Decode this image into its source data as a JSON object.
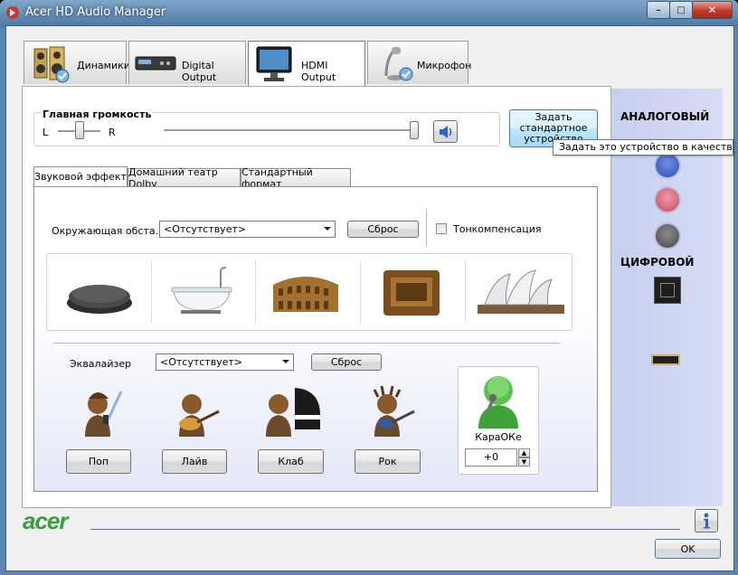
{
  "window": {
    "title": "Acer HD Audio Manager",
    "minimize": "–",
    "maximize": "□",
    "close": "✕"
  },
  "tabs": [
    {
      "label": "Динамики",
      "icon": "speakers-icon"
    },
    {
      "label": "Digital Output",
      "icon": "digital-output-icon"
    },
    {
      "label": "HDMI Output",
      "icon": "monitor-icon"
    },
    {
      "label": "Микрофон",
      "icon": "microphone-icon"
    }
  ],
  "volume": {
    "title": "Главная громкость",
    "left": "L",
    "right": "R",
    "balance_percent": 50,
    "level_percent": 100,
    "mute_icon": "speaker-icon"
  },
  "default_button": {
    "label": "Задать стандартное устройство",
    "tooltip": "Задать это устройство в качестве ста"
  },
  "subtabs": [
    "Звуковой эффект",
    "Домашний театр Dolby",
    "Стандартный формат"
  ],
  "environment": {
    "label": "Окружающая обста...",
    "value": "<Отсутствует>",
    "reset": "Сброс",
    "loudness": "Тонкомпенсация"
  },
  "environment_presets": [
    "stone-room-icon",
    "bathroom-icon",
    "colosseum-icon",
    "arena-icon",
    "opera-house-icon"
  ],
  "equalizer": {
    "label": "Эквалайзер",
    "value": "<Отсутствует>",
    "reset": "Сброс"
  },
  "eq_presets": [
    {
      "label": "Поп",
      "icon": "pop-singer-icon"
    },
    {
      "label": "Лайв",
      "icon": "live-guitar-icon"
    },
    {
      "label": "Клаб",
      "icon": "club-piano-icon"
    },
    {
      "label": "Рок",
      "icon": "rock-guitar-icon"
    }
  ],
  "karaoke": {
    "label": "КараОКе",
    "value": "+0",
    "icon": "karaoke-singer-icon"
  },
  "right_panel": {
    "analog": "АНАЛОГОВЫЙ",
    "digital": "ЦИФРОВОЙ",
    "jack_colors": [
      "#3d63c8",
      "#d16075",
      "#6e6e6e"
    ]
  },
  "footer": {
    "logo": "acer",
    "info_icon": "info-icon",
    "ok": "OK"
  }
}
